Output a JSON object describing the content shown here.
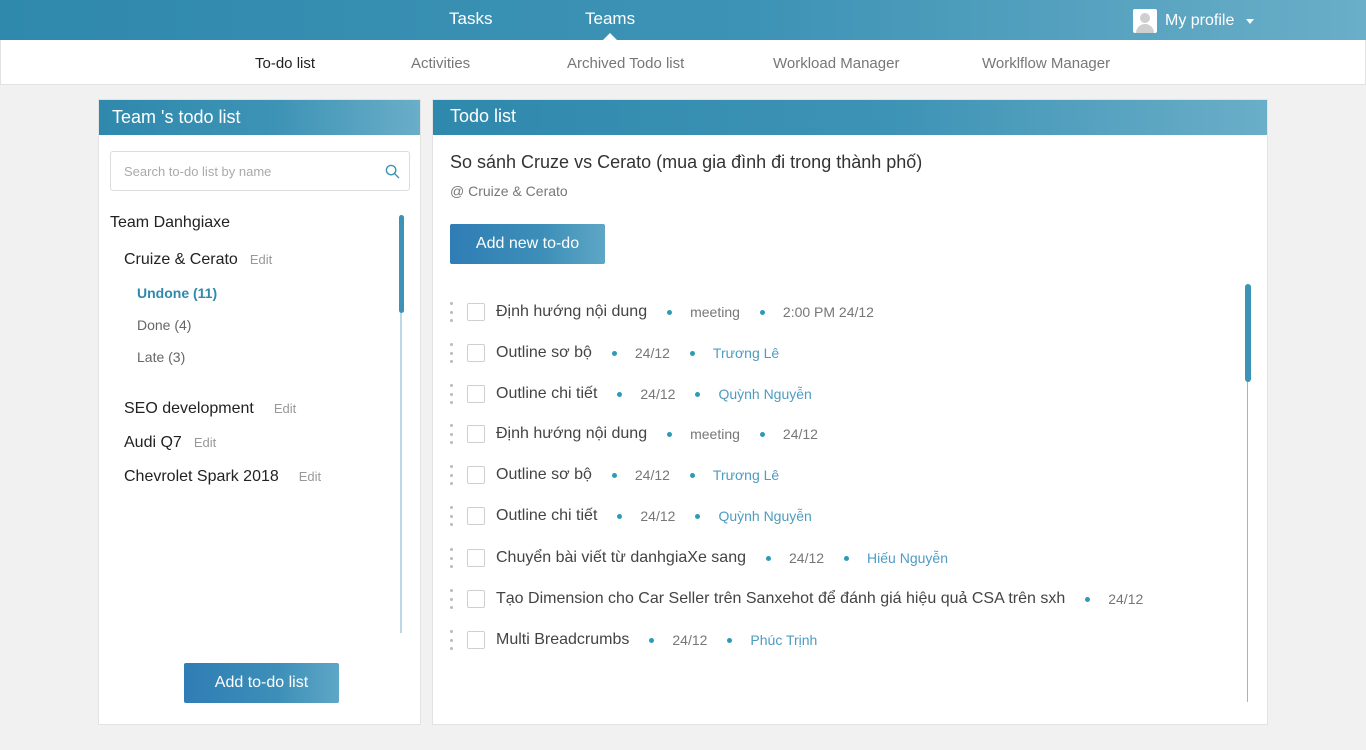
{
  "topnav": {
    "tasks": "Tasks",
    "teams": "Teams",
    "profile": "My profile"
  },
  "subnav": {
    "items": [
      "To-do list",
      "Activities",
      "Archived Todo list",
      "Workload Manager",
      "Worklflow Manager"
    ],
    "active": "To-do list"
  },
  "left_panel": {
    "title": "Team 's todo list",
    "search_placeholder": "Search to-do list by name",
    "team_name": "Team Danhgiaxe",
    "edit_label": "Edit",
    "lists": [
      {
        "name": "Cruize & Cerato",
        "edit": "Edit"
      },
      {
        "name": "SEO development",
        "edit": "Edit"
      },
      {
        "name": "Audi Q7",
        "edit": "Edit"
      },
      {
        "name": "Chevrolet Spark 2018",
        "edit": "Edit"
      }
    ],
    "filters": [
      "Undone (11)",
      "Done (4)",
      "Late (3)"
    ],
    "active_filter": "Undone (11)",
    "add_button": "Add to-do list"
  },
  "right_panel": {
    "title": "Todo list",
    "list_title": "So sánh Cruze vs Cerato (mua gia đình đi trong thành phố)",
    "list_subtitle": "@ Cruize & Cerato",
    "add_button": "Add new to-do",
    "todos": [
      {
        "name": "Định hướng nội dung",
        "meta1": "meeting",
        "meta2": "2:00 PM 24/12"
      },
      {
        "name": "Outline sơ bộ",
        "meta1": "24/12",
        "assignee": "Trương Lê"
      },
      {
        "name": "Outline chi tiết",
        "meta1": "24/12",
        "assignee": "Quỳnh Nguyễn"
      },
      {
        "name": "Định hướng nội dung",
        "meta1": "meeting",
        "meta2": "24/12"
      },
      {
        "name": "Outline sơ bộ",
        "meta1": "24/12",
        "assignee": "Trương Lê"
      },
      {
        "name": "Outline chi tiết",
        "meta1": "24/12",
        "assignee": "Quỳnh Nguyễn"
      },
      {
        "name": "Chuyển bài viết từ danhgiaXe sang",
        "meta1": "24/12",
        "assignee": "Hiếu Nguyễn"
      },
      {
        "name": "Tạo Dimension cho Car Seller trên Sanxehot để đánh giá hiệu quả CSA trên sxh",
        "meta1": "24/12"
      },
      {
        "name": "Multi Breadcrumbs",
        "meta1": "24/12",
        "assignee": "Phúc Trịnh"
      }
    ]
  },
  "colors": {
    "accent": "#2f89ad",
    "accent_light": "#6aaec8",
    "link": "#4d9cc2"
  }
}
